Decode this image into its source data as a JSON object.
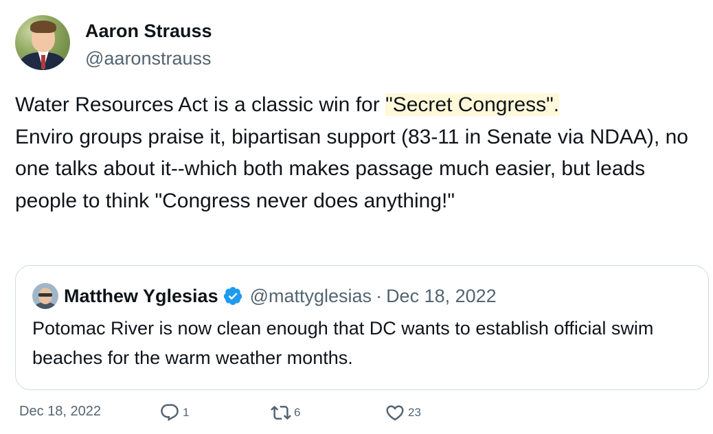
{
  "author": {
    "display_name": "Aaron Strauss",
    "handle": "@aaronstrauss"
  },
  "tweet": {
    "text_before_highlight": "Water Resources Act is a classic win for ",
    "highlight": "\"Secret Congress\".",
    "text_after_highlight": "\nEnviro groups praise it, bipartisan support (83-11 in Senate via NDAA), no one talks about it--which both makes passage much easier, but leads people to think \"Congress never does anything!\""
  },
  "quoted": {
    "display_name": "Matthew Yglesias",
    "handle": "@mattyglesias",
    "separator": "·",
    "date": "Dec 18, 2022",
    "text": "Potomac River is now clean enough that DC wants to establish official swim beaches for the warm weather months.",
    "verified_icon": "verified-badge-icon"
  },
  "footer": {
    "date": "Dec 18, 2022",
    "replies": "1",
    "retweets": "6",
    "likes": "23"
  },
  "colors": {
    "text": "#0f1419",
    "secondary": "#536471",
    "border": "#cfd9de",
    "highlight": "#fff8d9",
    "verified": "#1d9bf0"
  }
}
